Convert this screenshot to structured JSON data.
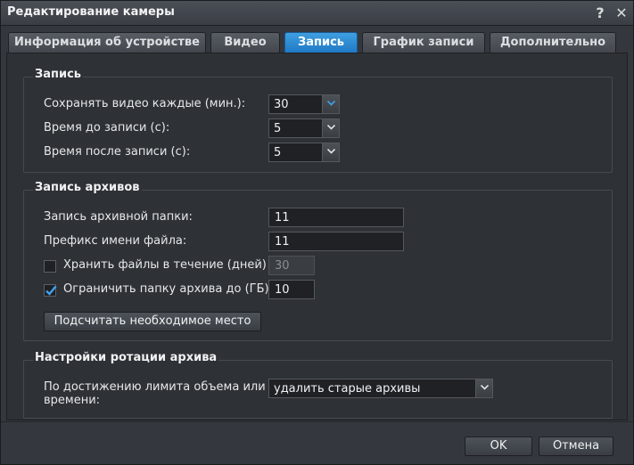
{
  "window": {
    "title": "Редактирование камеры",
    "help_glyph": "?",
    "close_glyph": "✕"
  },
  "tabs": [
    {
      "label": "Информация об устройстве",
      "active": false
    },
    {
      "label": "Видео",
      "active": false
    },
    {
      "label": "Запись",
      "active": true
    },
    {
      "label": "График записи",
      "active": false
    },
    {
      "label": "Дополнительно",
      "active": false
    }
  ],
  "recording": {
    "title": "Запись",
    "save_every_label": "Сохранять видео каждые (мин.):",
    "save_every_value": "30",
    "pre_record_label": "Время до записи (с):",
    "pre_record_value": "5",
    "post_record_label": "Время после записи (с):",
    "post_record_value": "5"
  },
  "archive": {
    "title": "Запись архивов",
    "folder_label": "Запись архивной папки:",
    "folder_value": "11",
    "prefix_label": "Префикс имени файла:",
    "prefix_value": "11",
    "keep_days_label": "Хранить файлы в течение (дней)",
    "keep_days_checked": false,
    "keep_days_value": "30",
    "limit_label": "Ограничить папку архива до (ГБ)",
    "limit_checked": true,
    "limit_value": "10",
    "calc_button": "Подсчитать необходимое место"
  },
  "rotation": {
    "title": "Настройки ротации архива",
    "on_limit_label_line1": "По достижению лимита объема или",
    "on_limit_label_line2": "времени:",
    "on_limit_value": "удалить старые архивы"
  },
  "footer": {
    "ok_label": "OK",
    "cancel_label": "Отмена"
  },
  "colors": {
    "accent": "#2b8ad6",
    "check": "#3fa3ef"
  }
}
